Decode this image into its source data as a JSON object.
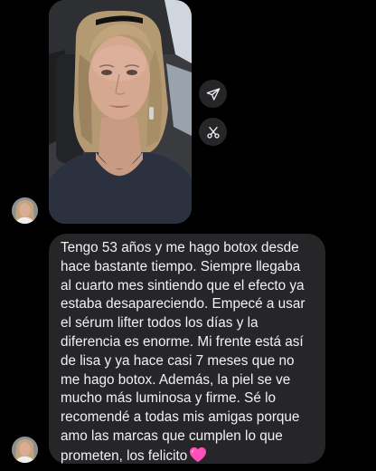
{
  "conversation": {
    "photo_message": {
      "kind": "photo",
      "subject": "selfie-in-car"
    },
    "actions": {
      "share_icon": "paper-plane-icon",
      "reshare_icon": "scissors-share-icon"
    },
    "text_message": {
      "lines": [
        "Tengo 53 años y me hago botox desde",
        "hace bastante tiempo. Siempre llegaba",
        "al cuarto mes sintiendo que el efecto ya",
        "estaba desapareciendo. Empecé a usar",
        "el sérum lifter todos los días y la",
        "diferencia es enorme. Mi frente está así",
        "de lisa y ya hace casi 7 meses que no",
        "me hago botox. Además, la piel se ve",
        "mucho más luminosa y firme. Sé lo",
        "recomendé a todas mis amigas porque",
        "amo las marcas que cumplen lo que",
        "prometen, los felicito"
      ],
      "emoji": "pink-heart-emoji"
    },
    "colors": {
      "background": "#000000",
      "bubble": "#262628",
      "text": "#f2f2f4",
      "heart": "#ff4fb8"
    }
  }
}
